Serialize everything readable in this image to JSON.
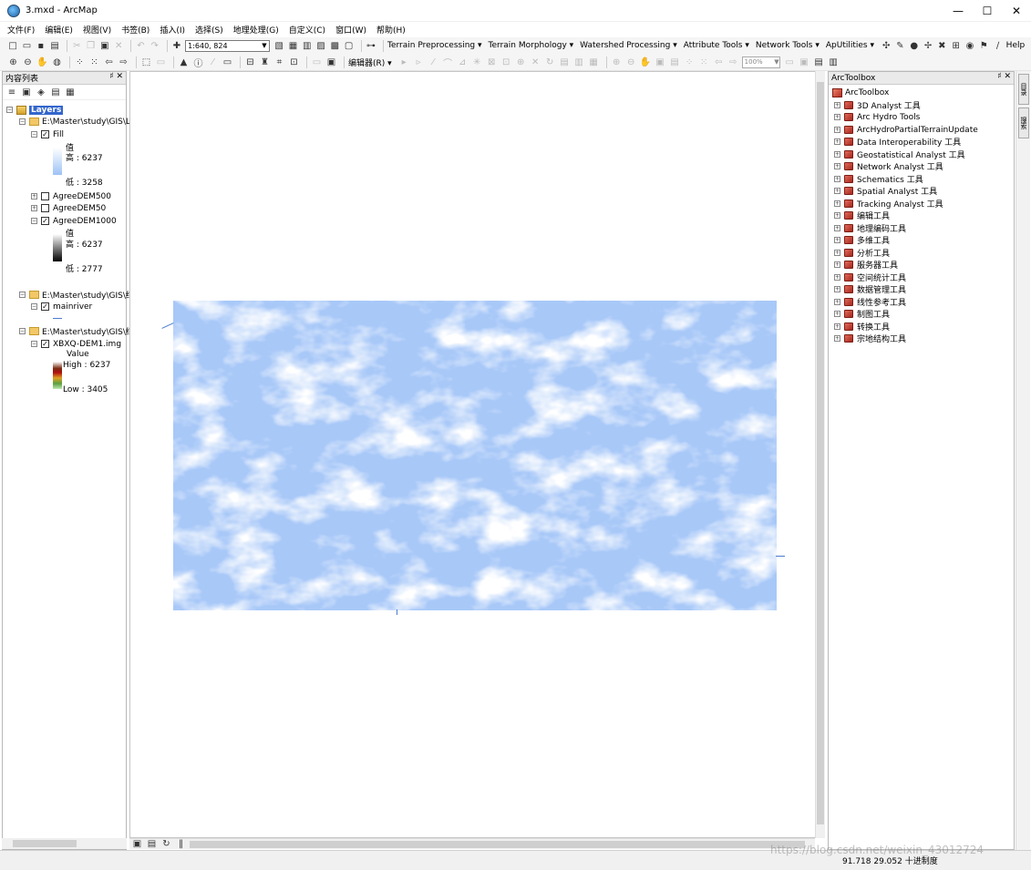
{
  "window": {
    "title": "3.mxd - ArcMap",
    "minimize": "—",
    "maximize": "☐",
    "close": "✕"
  },
  "menubar": [
    "文件(F)",
    "编辑(E)",
    "视图(V)",
    "书签(B)",
    "插入(I)",
    "选择(S)",
    "地理处理(G)",
    "自定义(C)",
    "窗口(W)",
    "帮助(H)"
  ],
  "toolbar1": {
    "scale": "1:640, 824",
    "menus": [
      "Terrain Preprocessing ▾",
      "Terrain Morphology ▾",
      "Watershed Processing ▾",
      "Attribute Tools ▾",
      "Network Tools ▾",
      "ApUtilities ▾"
    ],
    "help": "Help"
  },
  "toolbar2": {
    "editor": "编辑器(R) ▾",
    "zoom": "100%"
  },
  "toc": {
    "title": "内容列表",
    "controls": "♯ ✕",
    "layers_root": "Layers",
    "group1": {
      "path": "E:\\Master\\study\\GIS\\La",
      "fill": {
        "name": "Fill",
        "legend_title": "值",
        "high": "高 : 6237",
        "low": "低 : 3258"
      },
      "agree500": "AgreeDEM500",
      "agree50": "AgreeDEM50",
      "agree1000": {
        "name": "AgreeDEM1000",
        "legend_title": "值",
        "high": "高 : 6237",
        "low": "低 : 2777"
      }
    },
    "group2": {
      "path": "E:\\Master\\study\\GIS\\结",
      "layer": "mainriver"
    },
    "group3": {
      "path": "E:\\Master\\study\\GIS\\结",
      "layer": {
        "name": "XBXQ-DEM1.img",
        "legend_title": "Value",
        "high": "High : 6237",
        "low": "Low : 3405"
      }
    }
  },
  "toolbox": {
    "title": "ArcToolbox",
    "controls": "♯ ✕",
    "root": "ArcToolbox",
    "items": [
      "3D Analyst 工具",
      "Arc Hydro Tools",
      "ArcHydroPartialTerrainUpdate",
      "Data Interoperability 工具",
      "Geostatistical Analyst 工具",
      "Network Analyst 工具",
      "Schematics 工具",
      "Spatial Analyst 工具",
      "Tracking Analyst 工具",
      "编辑工具",
      "地理编码工具",
      "多维工具",
      "分析工具",
      "服务器工具",
      "空间统计工具",
      "数据管理工具",
      "线性参考工具",
      "制图工具",
      "转换工具",
      "宗地结构工具"
    ]
  },
  "side_tabs": [
    "目录",
    "搜索"
  ],
  "status": {
    "coordinates": "91.718  29.052 十进制度"
  },
  "watermark": "https://blog.csdn.net/weixin_43012724",
  "colors": {
    "dem_low": "#a8c8f8",
    "dem_high": "#ffffff",
    "selection": "#3366cc"
  }
}
